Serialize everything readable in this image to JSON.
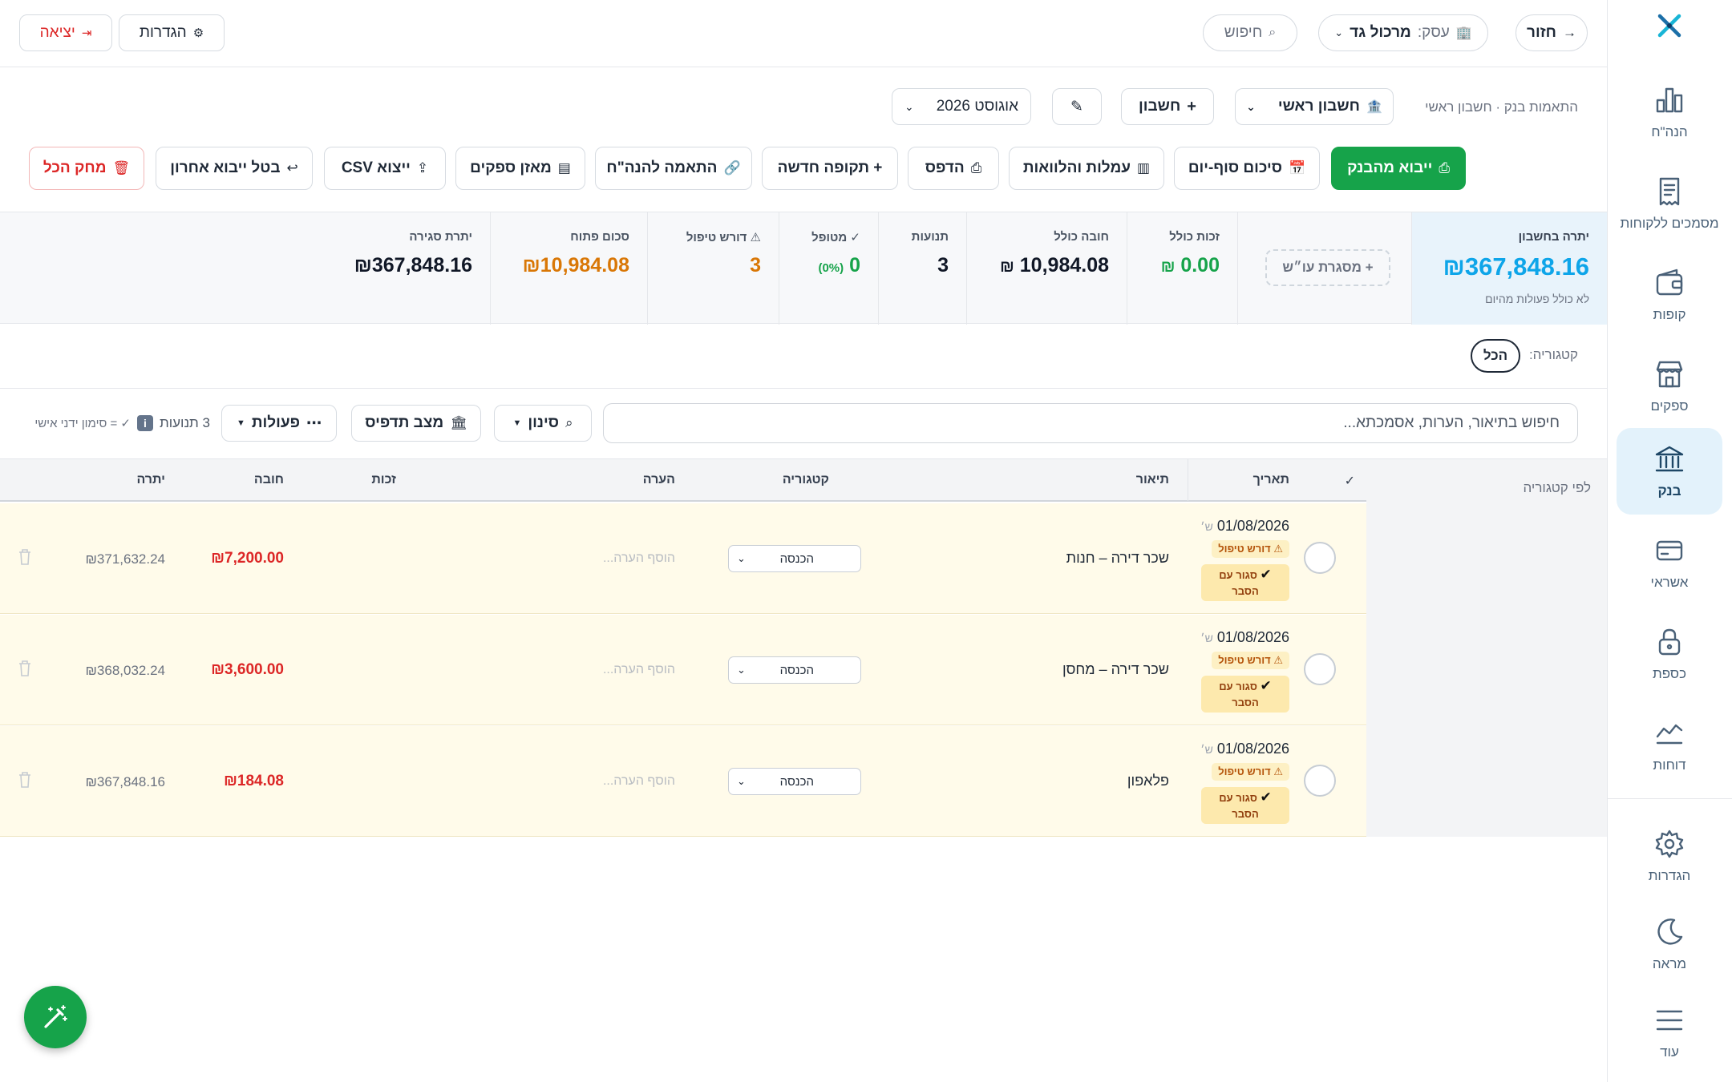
{
  "sidebar": {
    "items": [
      {
        "label": "הנה\"ח"
      },
      {
        "label": "מסמכים ללקוחות"
      },
      {
        "label": "קופות"
      },
      {
        "label": "ספקים"
      },
      {
        "label": "בנק"
      },
      {
        "label": "אשראי"
      },
      {
        "label": "כספת"
      },
      {
        "label": "דוחות"
      },
      {
        "label": "הגדרות"
      },
      {
        "label": "מראה"
      },
      {
        "label": "עוד"
      }
    ]
  },
  "topbar": {
    "back_label": "חזור",
    "business_prefix": "עסק:",
    "business_name": "מרכול גד",
    "search_placeholder": "חיפוש",
    "settings_label": "הגדרות",
    "logout_label": "יציאה"
  },
  "account": {
    "breadcrumb": "התאמות בנק · חשבון ראשי",
    "account_select": "חשבון ראשי",
    "add_account_label": "חשבון",
    "edit_icon": "✎",
    "period_select": "אוגוסט 2026"
  },
  "actions": {
    "import_bank": "ייבוא מהבנק",
    "end_of_day": "סיכום סוף-יום",
    "fees_loans": "עמלות והלוואות",
    "print": "הדפס",
    "new_period": "+ תקופה חדשה",
    "match_accounting": "התאמה להנה\"ח",
    "supplier_balance": "מאזן ספקים",
    "export_csv": "ייצוא CSV",
    "undo_import": "בטל ייבוא אחרון",
    "delete_all": "מחק הכל"
  },
  "stats": {
    "balance_label": "יתרה בחשבון",
    "balance_value": "₪367,848.16",
    "balance_note": "לא כולל פעולות מהיום",
    "frame_label": "+ מסגרת עו״ש",
    "credit_label": "זכות כולל",
    "credit_value": "0.00",
    "debit_label": "חובה כולל",
    "debit_value": "10,984.08",
    "tx_label": "תנועות",
    "tx_value": "3",
    "handled_label": "✓ מטופל",
    "handled_value": "0",
    "handled_pct": "(0%)",
    "needs_label": "⚠ דורש טיפול",
    "needs_value": "3",
    "open_label": "סכום פתוח",
    "open_value": "₪10,984.08",
    "closing_label": "יתרת סגירה",
    "closing_value": "₪367,848.16",
    "currency": "₪"
  },
  "filters": {
    "category_label": "קטגוריה:",
    "category_all": "הכל",
    "search_placeholder": "חיפוש בתיאור, הערות, אסמכתא...",
    "filter_label": "סינון",
    "print_state_label": "מצב תדפיס",
    "actions_label": "פעולות",
    "tx_count": "3 תנועות",
    "manual_legend": "✓ = סימון ידני אישי"
  },
  "table": {
    "columns": {
      "check": "✓",
      "date": "תאריך",
      "desc": "תיאור",
      "category": "קטגוריה",
      "note": "הערה",
      "credit": "זכות",
      "debit": "חובה",
      "balance": "יתרה"
    },
    "by_category_label": "לפי קטגוריה",
    "rows": [
      {
        "date": "01/08/2026",
        "day": "ש׳",
        "warn": "⚠ דורש טיפול",
        "closed_1": "סגור עם",
        "closed_2": "הסבר",
        "desc": "שכר דירה – חנות",
        "category": "הכנסה",
        "note": "הוסף הערה...",
        "debit": "₪7,200.00",
        "balance": "₪371,632.24"
      },
      {
        "date": "01/08/2026",
        "day": "ש׳",
        "warn": "⚠ דורש טיפול",
        "closed_1": "סגור עם",
        "closed_2": "הסבר",
        "desc": "שכר דירה – מחסן",
        "category": "הכנסה",
        "note": "הוסף הערה...",
        "debit": "₪3,600.00",
        "balance": "₪368,032.24"
      },
      {
        "date": "01/08/2026",
        "day": "ש׳",
        "warn": "⚠ דורש טיפול",
        "closed_1": "סגור עם",
        "closed_2": "הסבר",
        "desc": "פלאפון",
        "category": "הכנסה",
        "note": "הוסף הערה...",
        "debit": "₪184.08",
        "balance": "₪367,848.16"
      }
    ]
  },
  "colors": {
    "primary_green": "#16a34a",
    "accent_blue": "#0ea5e9",
    "danger_red": "#dc2626",
    "warning_orange": "#d97706"
  }
}
